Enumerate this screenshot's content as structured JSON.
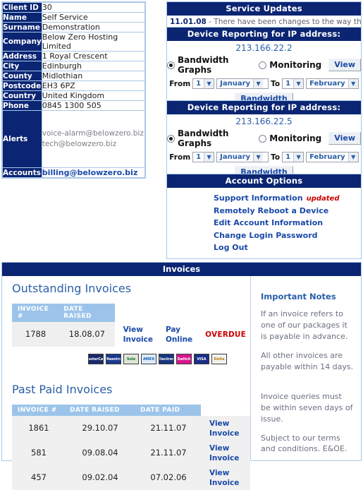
{
  "client": {
    "rows": [
      {
        "label": "Client ID",
        "value": "30"
      },
      {
        "label": "Name",
        "value": "Self Service"
      },
      {
        "label": "Surname",
        "value": "Demonstration"
      },
      {
        "label": "Company",
        "value": "Below Zero Hosting Limited"
      },
      {
        "label": "Address",
        "value": "1 Royal Crescent"
      },
      {
        "label": "City",
        "value": "Edinburgh"
      },
      {
        "label": "County",
        "value": "Midlothian"
      },
      {
        "label": "Postcode",
        "value": "EH3 6PZ"
      },
      {
        "label": "Country",
        "value": "United Kingdom"
      },
      {
        "label": "Phone",
        "value": "0845 1300 505"
      }
    ],
    "alerts_label": "Alerts",
    "alerts_email_1": "voice-alarm@belowzero.biz",
    "alerts_email_2": "tech@belowzero.biz",
    "accounts_label": "Accounts",
    "accounts_email": "billing@belowzero.biz"
  },
  "service_updates": {
    "title": "Service Updates",
    "date": "11.01.08",
    "text": "- There have been changes to the way that PI"
  },
  "devices": [
    {
      "title": "Device Reporting for IP address:",
      "ip": "213.166.22.2",
      "option_bandwidth": "Bandwidth Graphs",
      "option_monitoring": "Monitoring",
      "selected": "bandwidth",
      "view_label": "View",
      "from_label": "From",
      "to_label": "To",
      "from_day": "1",
      "from_month": "January",
      "to_day": "1",
      "to_month": "February",
      "submit_label": "Bandwidth"
    },
    {
      "title": "Device Reporting for IP address:",
      "ip": "213.166.22.5",
      "option_bandwidth": "Bandwidth Graphs",
      "option_monitoring": "Monitoring",
      "selected": "bandwidth",
      "view_label": "View",
      "from_label": "From",
      "to_label": "To",
      "from_day": "1",
      "from_month": "January",
      "to_day": "1",
      "to_month": "February",
      "submit_label": "Bandwidth"
    }
  ],
  "account_options": {
    "title": "Account Options",
    "links": [
      {
        "label": "Support Information",
        "badge": "updated"
      },
      {
        "label": "Remotely Reboot a Device",
        "badge": ""
      },
      {
        "label": "Edit Account Information",
        "badge": ""
      },
      {
        "label": "Change Login Password",
        "badge": ""
      },
      {
        "label": "Log Out",
        "badge": ""
      }
    ]
  },
  "invoices": {
    "title": "Invoices",
    "outstanding_title": "Outstanding Invoices",
    "outstanding_headers": [
      "INVOICE #",
      "DATE RAISED"
    ],
    "outstanding_rows": [
      {
        "invoice": "1788",
        "date_raised": "18.08.07",
        "view_label": "View Invoice",
        "pay_label": "Pay Online",
        "status": "OVERDUE"
      }
    ],
    "cards": [
      {
        "name": "mastercard-card-icon",
        "text": "MasterCard",
        "cls": "c-mc"
      },
      {
        "name": "maestro-card-icon",
        "text": "Maestro",
        "cls": "c-maestro"
      },
      {
        "name": "solo-card-icon",
        "text": "Solo",
        "cls": "c-solo"
      },
      {
        "name": "amex-card-icon",
        "text": "AMEX",
        "cls": "c-amex"
      },
      {
        "name": "visa-electron-card-icon",
        "text": "Electron",
        "cls": "c-electron"
      },
      {
        "name": "switch-card-icon",
        "text": "Switch",
        "cls": "c-switch"
      },
      {
        "name": "visa-card-icon",
        "text": "VISA",
        "cls": "c-visa"
      },
      {
        "name": "visa-delta-card-icon",
        "text": "Delta",
        "cls": "c-delta"
      }
    ],
    "past_title": "Past Paid Invoices",
    "past_headers": [
      "INVOICE #",
      "DATE RAISED",
      "DATE PAID"
    ],
    "past_rows": [
      {
        "invoice": "1861",
        "date_raised": "29.10.07",
        "date_paid": "21.11.07",
        "view_label": "View Invoice"
      },
      {
        "invoice": "581",
        "date_raised": "09.08.04",
        "date_paid": "21.11.07",
        "view_label": "View Invoice"
      },
      {
        "invoice": "457",
        "date_raised": "09.02.04",
        "date_paid": "07.02.06",
        "view_label": "View Invoice"
      }
    ],
    "notes_title": "Important Notes",
    "notes": [
      "If an invoice refers to one of our packages it is payable in advance.",
      "All other invoices are payable within 14 days.",
      "Invoice queries must be within seven days of issue.",
      "Subject to our terms and conditions. E&OE."
    ]
  }
}
